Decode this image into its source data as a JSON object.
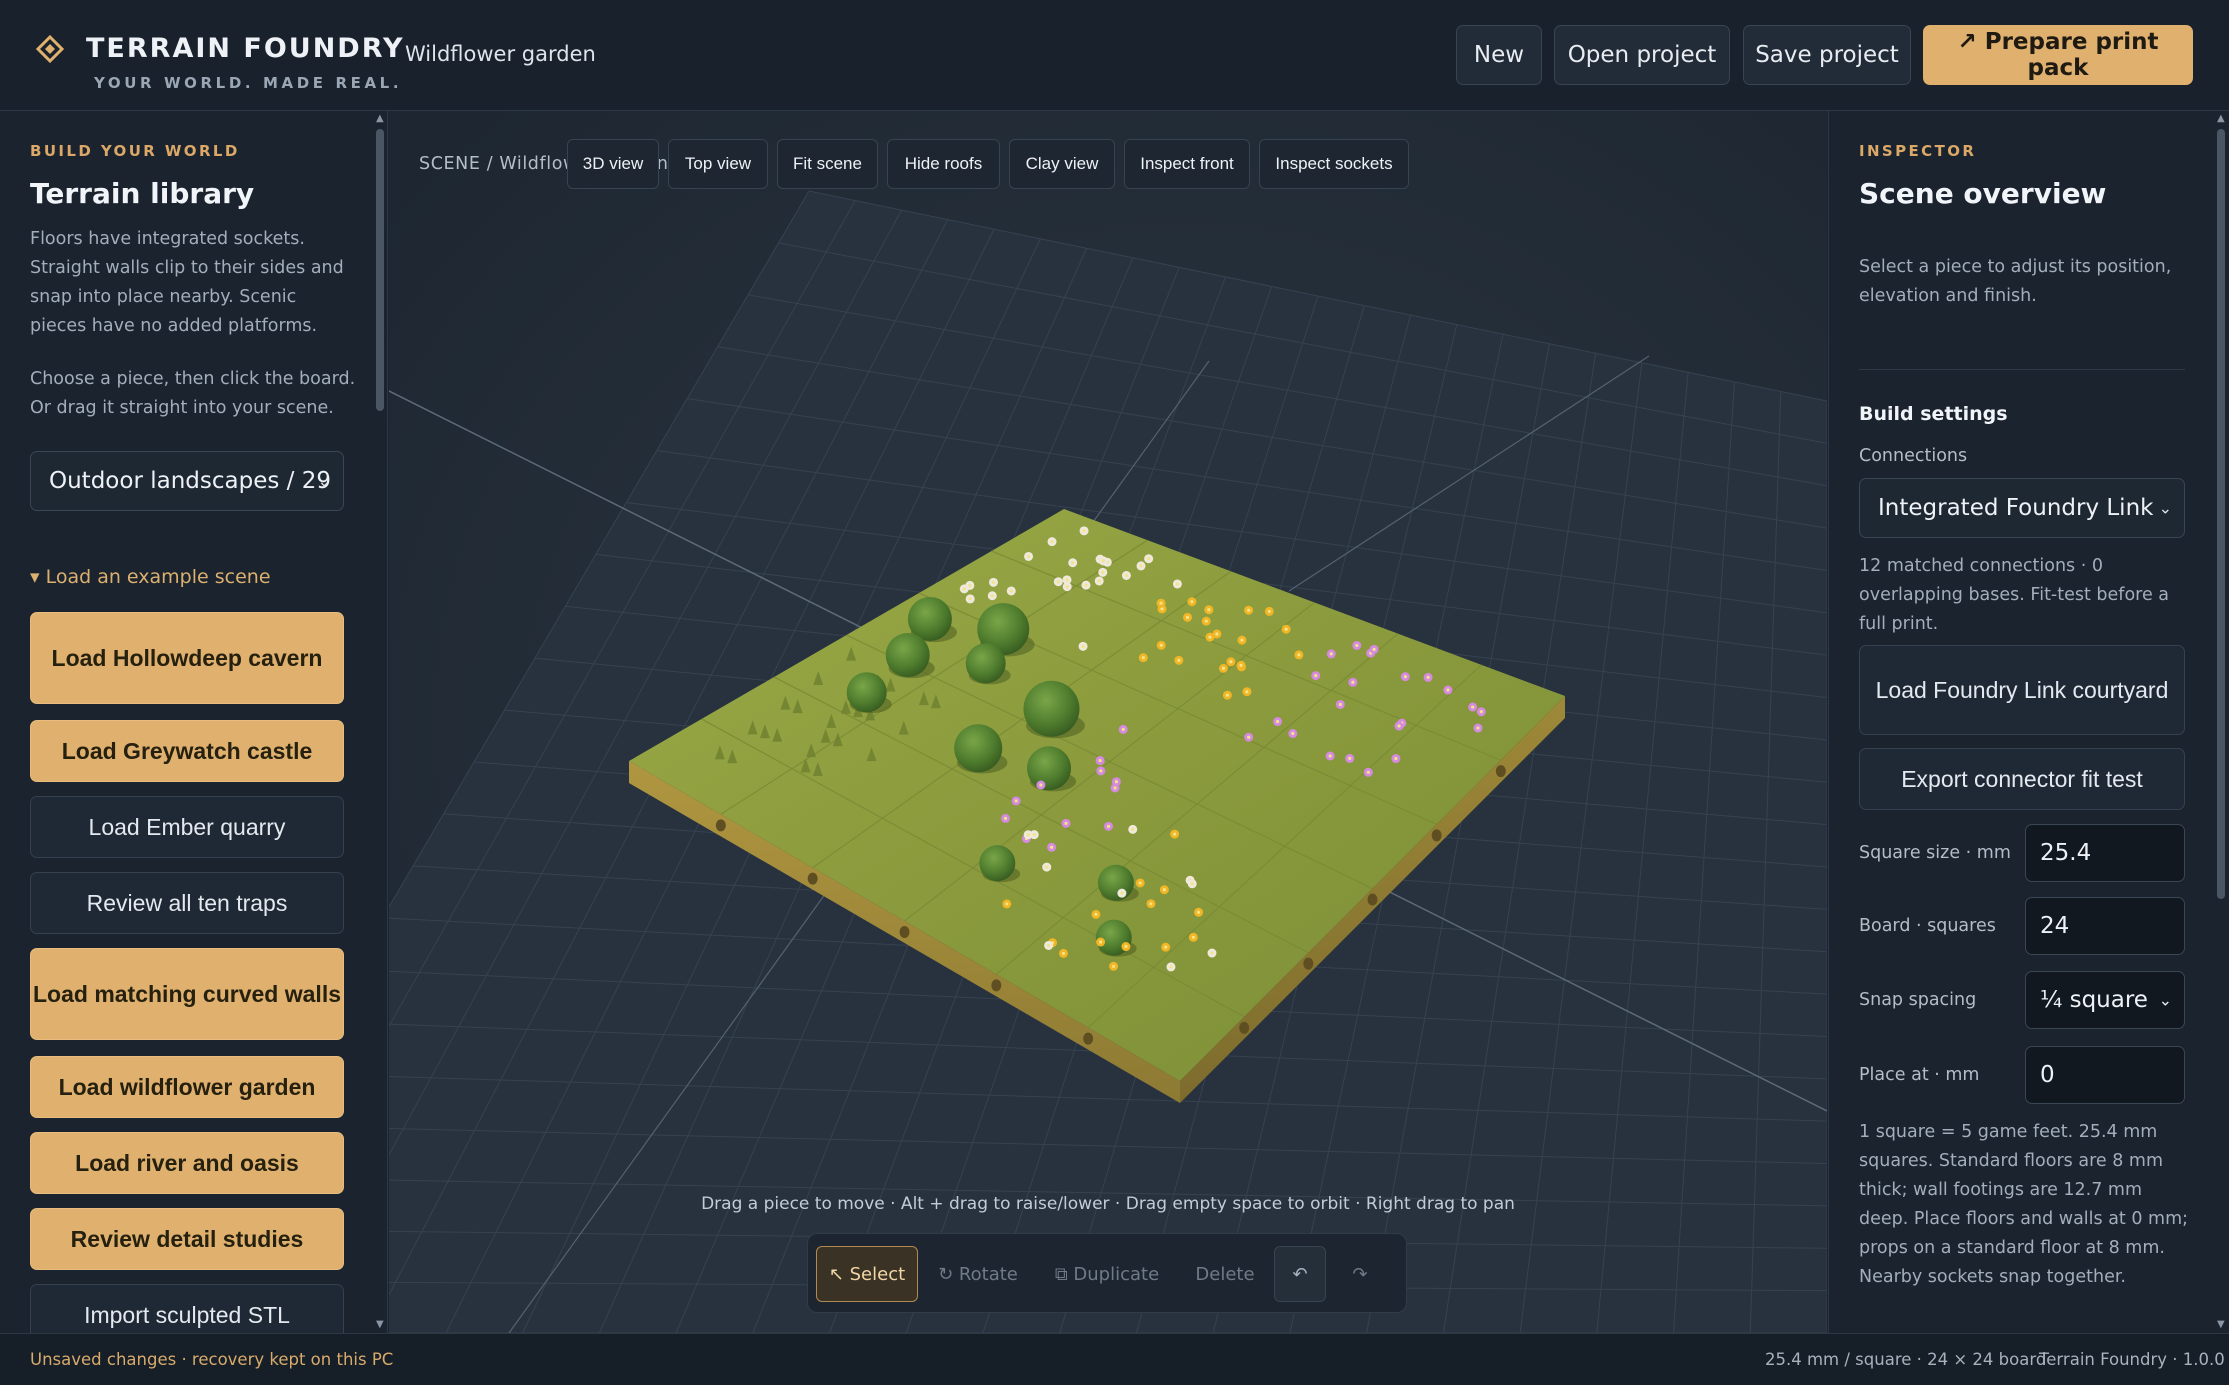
{
  "header": {
    "brand_name": "TERRAIN FOUNDRY",
    "brand_tagline": "YOUR WORLD. MADE REAL.",
    "project_title": "Wildflower garden",
    "buttons": {
      "new": "New",
      "open": "Open project",
      "save": "Save project",
      "prepare": "↗ Prepare print pack"
    },
    "accent_color": "#dfb06e"
  },
  "library": {
    "kicker": "BUILD YOUR WORLD",
    "title": "Terrain library",
    "description": "Floors have integrated sockets. Straight walls clip to their sides and snap into place nearby. Scenic pieces have no added platforms.",
    "instructions": "Choose a piece, then click the board. Or drag it straight into your scene.",
    "category_select": "Outdoor landscapes / 29",
    "examples_toggle": "▾ Load an example scene",
    "examples": [
      {
        "label": "Load Hollowdeep cavern",
        "style": "gold"
      },
      {
        "label": "Load Greywatch castle",
        "style": "gold"
      },
      {
        "label": "Load Ember quarry",
        "style": "dark"
      },
      {
        "label": "Review all ten traps",
        "style": "dark"
      },
      {
        "label": "Load matching curved walls",
        "style": "gold"
      },
      {
        "label": "Load wildflower garden",
        "style": "gold"
      },
      {
        "label": "Load river and oasis",
        "style": "gold"
      },
      {
        "label": "Review detail studies",
        "style": "gold"
      },
      {
        "label": "Import sculpted STL",
        "style": "dark"
      }
    ]
  },
  "viewport": {
    "breadcrumb": "SCENE / Wildflower garden",
    "view_buttons": [
      "3D view",
      "Top view",
      "Fit scene",
      "Hide roofs",
      "Clay view",
      "Inspect front",
      "Inspect sockets"
    ],
    "hint": "Drag a piece to move · Alt + drag to raise/lower · Drag empty space to orbit · Right drag to pan",
    "tools": {
      "select": "↖ Select",
      "rotate": "↻ Rotate",
      "duplicate": "⧉ Duplicate",
      "delete": "Delete",
      "undo": "↶",
      "redo": "↷"
    },
    "grass_color": "#8a9a3c",
    "base_color": "#a88f3e"
  },
  "inspector": {
    "kicker": "INSPECTOR",
    "title": "Scene overview",
    "description": "Select a piece to adjust its position, elevation and finish.",
    "build_settings_title": "Build settings",
    "connections_label": "Connections",
    "connections_value": "Integrated Foundry Link",
    "connections_status": "12 matched connections · 0 overlapping bases. Fit-test before a full print.",
    "load_courtyard": "Load Foundry Link courtyard",
    "export_fit_test": "Export connector fit test",
    "fields": {
      "square_size_label": "Square size · mm",
      "square_size_value": "25.4",
      "board_label": "Board · squares",
      "board_value": "24",
      "snap_label": "Snap spacing",
      "snap_value": "¼ square",
      "place_label": "Place at · mm",
      "place_value": "0"
    },
    "notes": "1 square = 5 game feet. 25.4 mm squares. Standard floors are 8 mm thick; wall footings are 12.7 mm deep. Place floors and walls at 0 mm; props on a standard floor at 8 mm. Nearby sockets snap together."
  },
  "status": {
    "left": "Unsaved changes · recovery kept on this PC",
    "board_info": "25.4 mm / square · 24 × 24 board",
    "version": "Terrain Foundry · 1.0.0"
  }
}
